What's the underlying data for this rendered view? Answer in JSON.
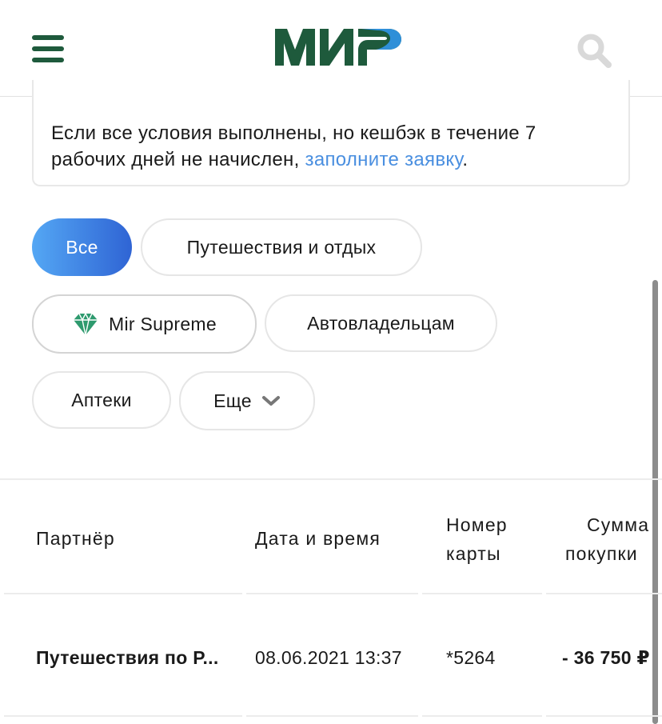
{
  "header": {
    "logo_text": "МИР",
    "brand_color": "#1e5a3c",
    "logo_accent": "#2f8fd8"
  },
  "notice": {
    "text": "Если все условия выполнены, но кешбэк в течение 7 рабочих дней не начислен,",
    "link_text": "заполните заявку",
    "tail": "."
  },
  "filters": {
    "all": "Все",
    "travel": "Путешествия и отдых",
    "supreme": "Mir Supreme",
    "auto": "Автовладельцам",
    "pharmacy": "Аптеки",
    "more": "Еще"
  },
  "table": {
    "headers": {
      "partner": "Партнёр",
      "datetime": "Дата и время",
      "card_line1": "Номер",
      "card_line2": "карты",
      "sum_line1": "Сумма",
      "sum_line2": "покупки"
    },
    "rows": [
      {
        "partner": "Путешествия по Р...",
        "datetime": "08.06.2021 13:37",
        "card": "*5264",
        "amount": "- 36 750 ₽"
      }
    ]
  }
}
